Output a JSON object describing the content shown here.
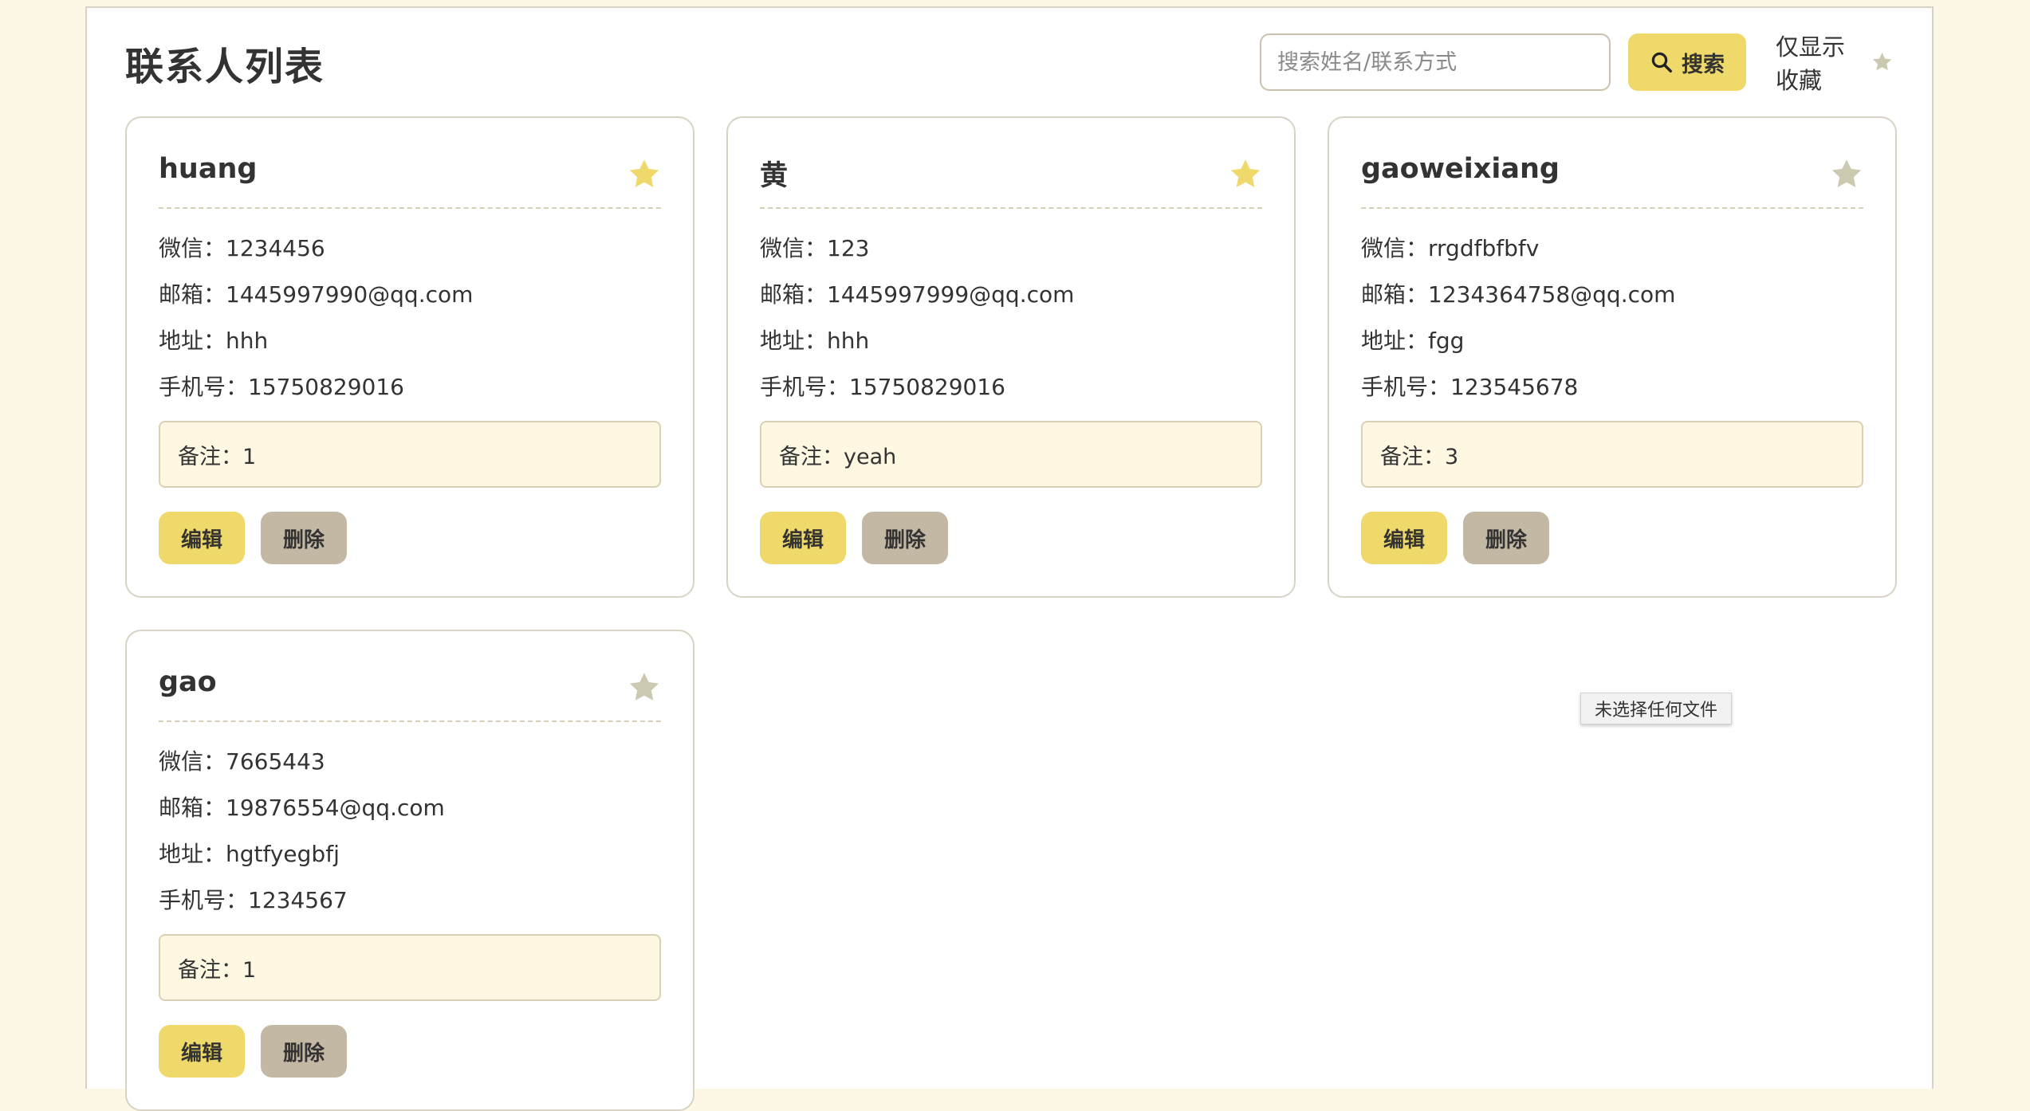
{
  "header": {
    "title": "联系人列表",
    "search_placeholder": "搜索姓名/联系方式",
    "search_value": "",
    "search_button_label": "搜索",
    "favorite_filter_label": "仅显示收藏"
  },
  "colors": {
    "accent": "#f0d96b",
    "star_active": "#f0d96b",
    "star_inactive": "#cbc9b0",
    "delete_button": "#c3b8a4",
    "note_background": "#fef8e2",
    "page_background": "#fdf8e6"
  },
  "icons": {
    "search": "search-icon",
    "star": "star-icon"
  },
  "contacts": [
    {
      "name": "huang",
      "favorite": true,
      "wechat": "微信：1234456",
      "email": "邮箱：1445997990@qq.com",
      "address": "地址：hhh",
      "phone": "手机号：15750829016",
      "note": "备注：1",
      "edit_label": "编辑",
      "delete_label": "删除"
    },
    {
      "name": "黄",
      "favorite": true,
      "wechat": "微信：123",
      "email": "邮箱：1445997999@qq.com",
      "address": "地址：hhh",
      "phone": "手机号：15750829016",
      "note": "备注：yeah",
      "edit_label": "编辑",
      "delete_label": "删除"
    },
    {
      "name": "gaoweixiang",
      "favorite": false,
      "wechat": "微信：rrgdfbfbfv",
      "email": "邮箱：1234364758@qq.com",
      "address": "地址：fgg",
      "phone": "手机号：123545678",
      "note": "备注：3",
      "edit_label": "编辑",
      "delete_label": "删除"
    },
    {
      "name": "gao",
      "favorite": false,
      "wechat": "微信：7665443",
      "email": "邮箱：19876554@qq.com",
      "address": "地址：hgtfyegbfj",
      "phone": "手机号：1234567",
      "note": "备注：1",
      "edit_label": "编辑",
      "delete_label": "删除"
    }
  ],
  "tooltip": {
    "text": "未选择任何文件"
  }
}
